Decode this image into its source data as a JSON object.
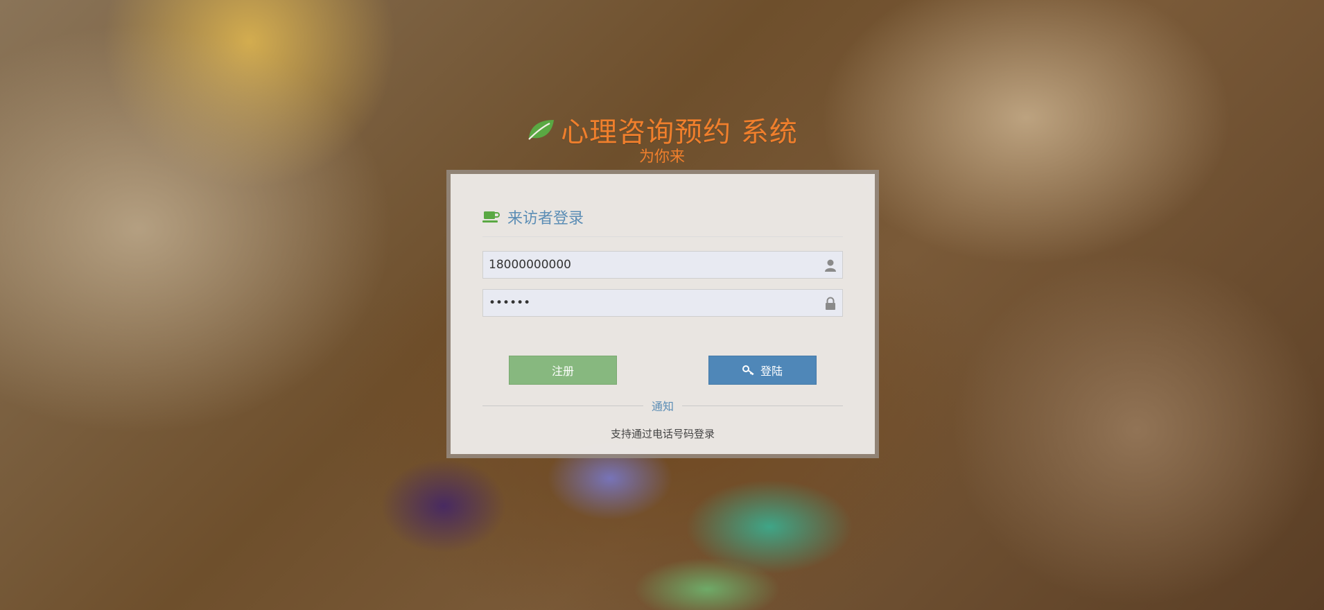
{
  "header": {
    "title": "心理咨询预约 系统",
    "subtitle": "为你来",
    "icon": "leaf-icon"
  },
  "login": {
    "title": "来访者登录",
    "title_icon": "coffee-icon",
    "phone_value": "18000000000",
    "password_value": "••••••",
    "register_label": "注册",
    "login_label": "登陆",
    "notice_heading": "通知",
    "notice_text": "支持通过电话号码登录"
  },
  "colors": {
    "accent_orange": "#f07f2c",
    "title_blue": "#5b8db5",
    "register_green": "#87b87f",
    "login_blue": "#4f87b8",
    "leaf_green": "#5aa843"
  }
}
